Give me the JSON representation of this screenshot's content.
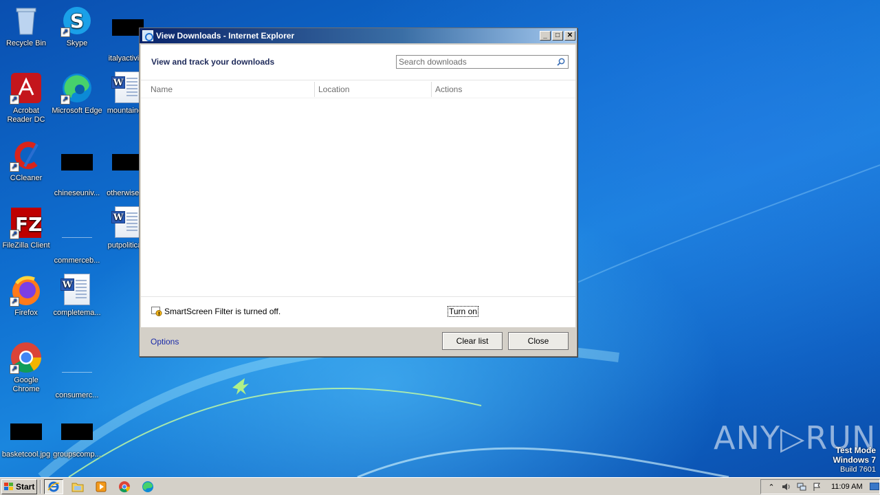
{
  "desktop": {
    "icons": [
      {
        "label": "Recycle Bin",
        "icon": "recycle-bin-icon"
      },
      {
        "label": "Skype",
        "icon": "skype-icon"
      },
      {
        "label": "italyactivit...",
        "icon": "black-thumbnail"
      },
      {
        "label": "Acrobat Reader DC",
        "icon": "acrobat-icon"
      },
      {
        "label": "Microsoft Edge",
        "icon": "edge-icon"
      },
      {
        "label": "mountaino...",
        "icon": "word-document-icon"
      },
      {
        "label": "CCleaner",
        "icon": "ccleaner-icon"
      },
      {
        "label": "chineseuniv...",
        "icon": "black-thumbnail"
      },
      {
        "label": "otherwises...",
        "icon": "black-thumbnail"
      },
      {
        "label": "FileZilla Client",
        "icon": "filezilla-icon"
      },
      {
        "label": "commerceb...",
        "icon": "blank-file-icon"
      },
      {
        "label": "putpolitica...",
        "icon": "word-document-icon"
      },
      {
        "label": "Firefox",
        "icon": "firefox-icon"
      },
      {
        "label": "completema...",
        "icon": "word-document-icon"
      },
      {
        "label": "Google Chrome",
        "icon": "chrome-icon"
      },
      {
        "label": "consumerc...",
        "icon": "blank-file-icon"
      },
      {
        "label": "basketcool.jpg",
        "icon": "black-thumbnail"
      },
      {
        "label": "groupscomp...",
        "icon": "black-thumbnail"
      }
    ]
  },
  "window": {
    "title": "View Downloads - Internet Explorer",
    "heading": "View and track your downloads",
    "search": {
      "placeholder": "Search downloads",
      "value": ""
    },
    "columns": [
      "Name",
      "Location",
      "Actions"
    ],
    "rows": [],
    "smartscreen": {
      "message": "SmartScreen Filter is turned off.",
      "action": "Turn on"
    },
    "footer": {
      "options": "Options",
      "clear_list": "Clear list",
      "close": "Close"
    },
    "controls": {
      "minimize": "_",
      "maximize": "□",
      "close": "✕"
    }
  },
  "watermark": {
    "brand": "ANY▷RUN",
    "mode": "Test Mode",
    "os": "Windows 7",
    "build": "Build 7601"
  },
  "taskbar": {
    "start_label": "Start",
    "apps": [
      "internet-explorer-icon",
      "explorer-folder-icon",
      "media-player-icon",
      "chrome-icon",
      "edge-icon"
    ],
    "clock": "11:09 AM"
  }
}
